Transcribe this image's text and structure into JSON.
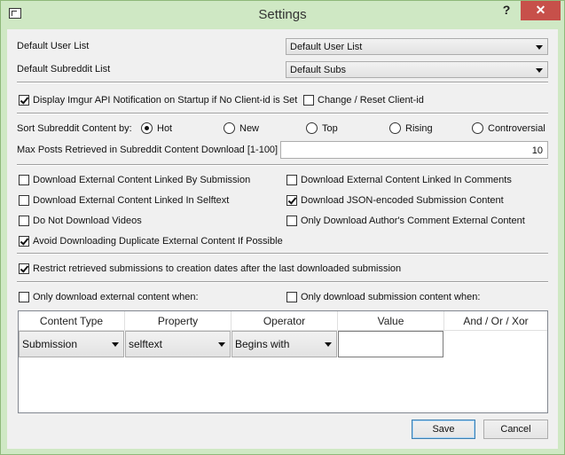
{
  "window": {
    "title": "Settings",
    "help_glyph": "?",
    "close_glyph": "✕"
  },
  "lists": {
    "user_label": "Default User List",
    "user_value": "Default User List",
    "subreddit_label": "Default Subreddit List",
    "subreddit_value": "Default Subs"
  },
  "imgur": {
    "display_label": "Display Imgur API Notification on Startup if No Client-id is Set",
    "display_checked": true,
    "change_label": "Change / Reset Client-id",
    "change_checked": false
  },
  "sort": {
    "label": "Sort Subreddit Content by:",
    "options": [
      {
        "label": "Hot",
        "selected": true
      },
      {
        "label": "New",
        "selected": false
      },
      {
        "label": "Top",
        "selected": false
      },
      {
        "label": "Rising",
        "selected": false
      },
      {
        "label": "Controversial",
        "selected": false
      }
    ],
    "max_posts_label": "Max Posts Retrieved in Subreddit Content Download [1-100]",
    "max_posts_value": "10"
  },
  "downloads": {
    "items": [
      {
        "label": "Download External Content Linked By Submission",
        "checked": false
      },
      {
        "label": "Download External Content Linked In Comments",
        "checked": false
      },
      {
        "label": "Download External Content Linked In Selftext",
        "checked": false
      },
      {
        "label": "Download JSON-encoded Submission Content",
        "checked": true
      },
      {
        "label": "Do Not Download Videos",
        "checked": false
      },
      {
        "label": "Only Download Author's Comment External Content",
        "checked": false
      },
      {
        "label": "Avoid Downloading Duplicate External Content If Possible",
        "checked": true
      }
    ]
  },
  "restrict": {
    "label": "Restrict retrieved submissions to creation dates after the last downloaded submission",
    "checked": true
  },
  "filters": {
    "external_label": "Only download external content when:",
    "external_checked": false,
    "submission_label": "Only download submission content when:",
    "submission_checked": false
  },
  "table": {
    "headers": [
      "Content Type",
      "Property",
      "Operator",
      "Value",
      "And / Or / Xor"
    ],
    "row": {
      "content_type": "Submission",
      "property": "selftext",
      "operator": "Begins with",
      "value": ""
    }
  },
  "buttons": {
    "save": "Save",
    "cancel": "Cancel"
  }
}
